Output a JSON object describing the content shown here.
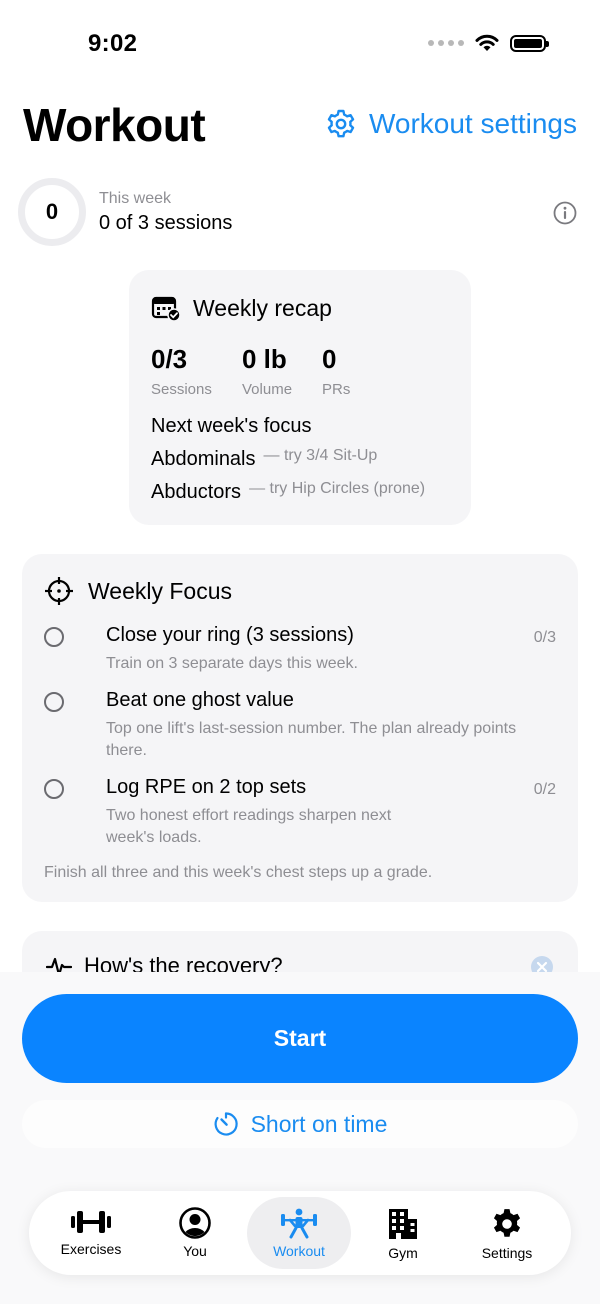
{
  "status": {
    "time": "9:02"
  },
  "header": {
    "title": "Workout",
    "settings_label": "Workout settings"
  },
  "progress": {
    "count": "0",
    "label": "This week",
    "value": "0 of 3 sessions",
    "sessions_done": 0,
    "sessions_goal": 3
  },
  "recap": {
    "title": "Weekly recap",
    "stats": [
      {
        "value": "0/3",
        "label": "Sessions"
      },
      {
        "value": "0 lb",
        "label": "Volume"
      },
      {
        "value": "0",
        "label": "PRs"
      }
    ],
    "focus_title": "Next week's focus",
    "focus_items": [
      {
        "muscle": "Abdominals",
        "suggestion": "— try 3/4 Sit-Up"
      },
      {
        "muscle": "Abductors",
        "suggestion": "— try Hip Circles (prone)"
      }
    ]
  },
  "weekly_focus": {
    "title": "Weekly Focus",
    "tasks": [
      {
        "title": "Close your ring (3 sessions)",
        "desc": "Train on 3 separate days this week.",
        "count": "0/3"
      },
      {
        "title": "Beat one ghost value",
        "desc": "Top one lift's last-session number. The plan already points there.",
        "count": ""
      },
      {
        "title": "Log RPE on 2 top sets",
        "desc": "Two honest effort readings sharpen next week's loads.",
        "count": "0/2"
      }
    ],
    "footer": "Finish all three and this week's chest steps up a grade."
  },
  "recovery": {
    "title": "How's the recovery?"
  },
  "actions": {
    "start_label": "Start",
    "short_label": "Short on time"
  },
  "tabs": [
    {
      "label": "Exercises",
      "icon": "dumbbell-icon"
    },
    {
      "label": "You",
      "icon": "person-icon"
    },
    {
      "label": "Workout",
      "icon": "weightlifter-icon"
    },
    {
      "label": "Gym",
      "icon": "building-icon"
    },
    {
      "label": "Settings",
      "icon": "gear-icon"
    }
  ],
  "colors": {
    "accent": "#0a84ff",
    "link": "#1a8cf0",
    "card": "#f5f5f7",
    "secondary_text": "#8e8e93"
  }
}
